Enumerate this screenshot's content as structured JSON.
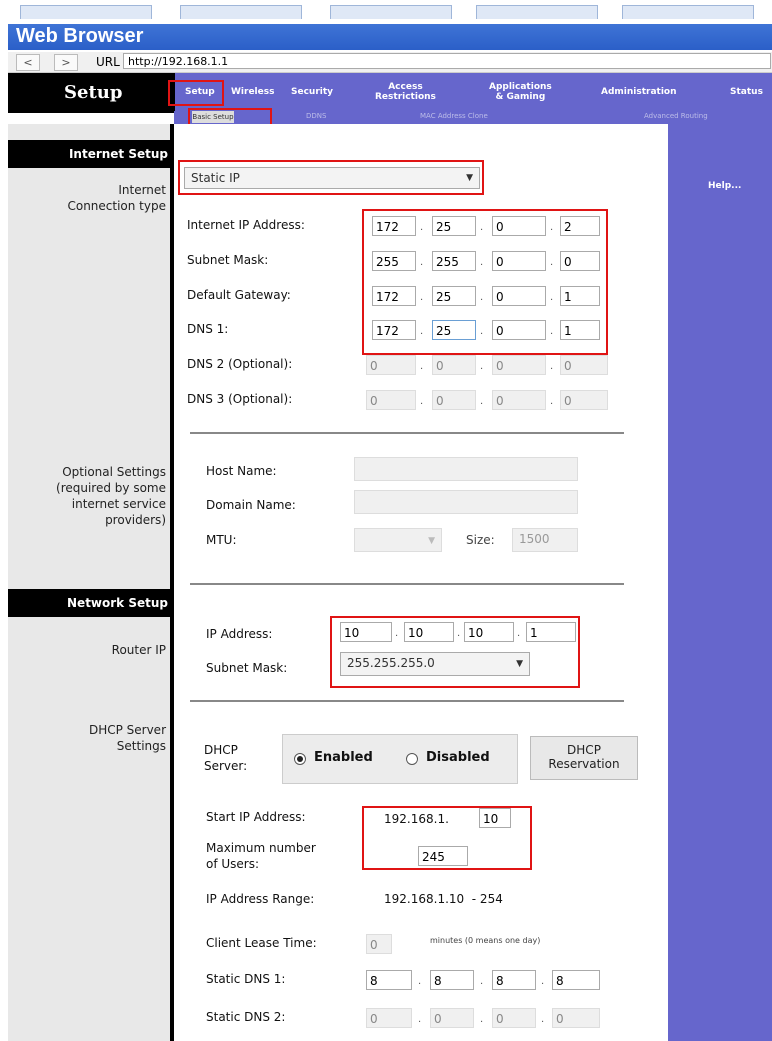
{
  "browser": {
    "title": "Web Browser",
    "back": "<",
    "forward": ">",
    "url_label": "URL",
    "url": "http://192.168.1.1"
  },
  "header": {
    "title": "Setup",
    "tabs": [
      {
        "label": "Setup"
      },
      {
        "label": "Wireless"
      },
      {
        "label": "Security"
      },
      {
        "label": "Access\nRestrictions"
      },
      {
        "label": "Applications\n& Gaming"
      },
      {
        "label": "Administration"
      },
      {
        "label": "Status"
      }
    ],
    "subtabs": [
      "Basic Setup",
      "DDNS",
      "MAC Address Clone",
      "Advanced Routing"
    ]
  },
  "sidebar": {
    "internet_setup": "Internet Setup",
    "connection_type_label": "Internet\nConnection type",
    "optional_settings_label": "Optional Settings\n(required by some\ninternet service\nproviders)",
    "network_setup": "Network Setup",
    "router_ip_label": "Router IP",
    "dhcp_label": "DHCP Server\nSettings"
  },
  "help": {
    "label": "Help..."
  },
  "internet": {
    "connection_type": "Static IP",
    "ip_label": "Internet IP Address:",
    "ip": [
      "172",
      "25",
      "0",
      "2"
    ],
    "mask_label": "Subnet Mask:",
    "mask": [
      "255",
      "255",
      "0",
      "0"
    ],
    "gateway_label": "Default Gateway:",
    "gateway": [
      "172",
      "25",
      "0",
      "1"
    ],
    "dns1_label": "DNS 1:",
    "dns1": [
      "172",
      "25",
      "0",
      "1"
    ],
    "dns2_label": "DNS 2 (Optional):",
    "dns2": [
      "0",
      "0",
      "0",
      "0"
    ],
    "dns3_label": "DNS 3 (Optional):",
    "dns3": [
      "0",
      "0",
      "0",
      "0"
    ]
  },
  "optional": {
    "host_label": "Host Name:",
    "domain_label": "Domain Name:",
    "mtu_label": "MTU:",
    "size_label": "Size:",
    "size_value": "1500"
  },
  "network": {
    "ip_label": "IP Address:",
    "ip": [
      "10",
      "10",
      "10",
      "1"
    ],
    "mask_label": "Subnet Mask:",
    "mask": "255.255.255.0"
  },
  "dhcp": {
    "server_label": "DHCP\nServer:",
    "enabled": "Enabled",
    "disabled": "Disabled",
    "reservation_button": "DHCP\nReservation",
    "start_label": "Start IP Address:",
    "start_prefix": "192.168.1.",
    "start_value": "10",
    "max_label": "Maximum number\nof Users:",
    "max_value": "245",
    "range_label": "IP Address Range:",
    "range_value": "192.168.1.10  - 254",
    "lease_label": "Client Lease Time:",
    "lease_value": "0",
    "lease_note": "minutes (0 means one day)",
    "static_dns1_label": "Static DNS 1:",
    "static_dns1": [
      "8",
      "8",
      "8",
      "8"
    ],
    "static_dns2_label": "Static DNS 2:",
    "static_dns2": [
      "0",
      "0",
      "0",
      "0"
    ]
  }
}
